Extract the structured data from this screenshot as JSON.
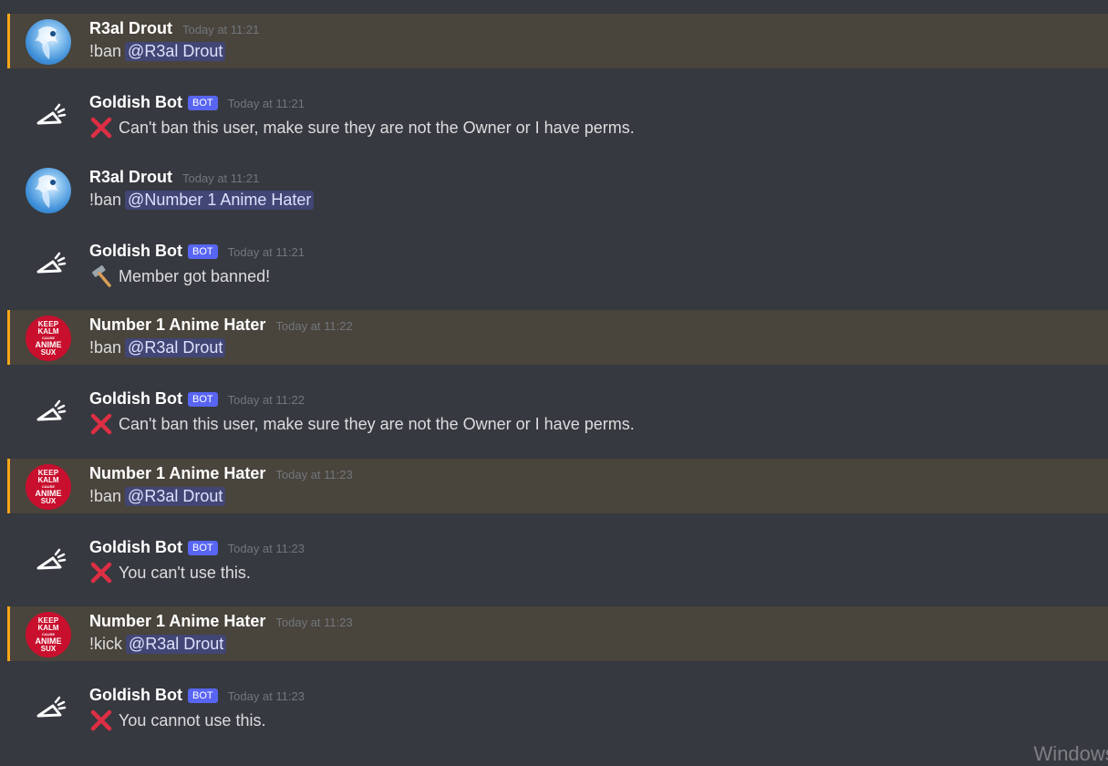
{
  "messages": [
    {
      "id": 1,
      "type": "user",
      "author": "R3al Drout",
      "avatar": "r3al-avatar",
      "timestamp": "Today at 11:21",
      "command": "!ban",
      "mention": "@R3al Drout",
      "highlighted": true
    },
    {
      "id": 2,
      "type": "bot",
      "author": "Goldish Bot",
      "bot_tag": "BOT",
      "avatar": "bot-broom-avatar",
      "timestamp": "Today at 11:21",
      "emoji": "cross-mark-icon",
      "text": "Can't ban this user, make sure they are not the Owner or I have perms."
    },
    {
      "id": 3,
      "type": "user",
      "author": "R3al Drout",
      "avatar": "r3al-avatar",
      "timestamp": "Today at 11:21",
      "command": "!ban",
      "mention": "@Number 1 Anime Hater",
      "highlighted": false
    },
    {
      "id": 4,
      "type": "bot",
      "author": "Goldish Bot",
      "bot_tag": "BOT",
      "avatar": "bot-broom-avatar",
      "timestamp": "Today at 11:21",
      "emoji": "hammer-icon",
      "text": "Member got banned!"
    },
    {
      "id": 5,
      "type": "user",
      "author": "Number 1 Anime Hater",
      "avatar": "keep-kalm-avatar",
      "timestamp": "Today at 11:22",
      "command": "!ban",
      "mention": "@R3al Drout",
      "highlighted": true
    },
    {
      "id": 6,
      "type": "bot",
      "author": "Goldish Bot",
      "bot_tag": "BOT",
      "avatar": "bot-broom-avatar",
      "timestamp": "Today at 11:22",
      "emoji": "cross-mark-icon",
      "text": "Can't ban this user, make sure they are not the Owner or I have perms."
    },
    {
      "id": 7,
      "type": "user",
      "author": "Number 1 Anime Hater",
      "avatar": "keep-kalm-avatar",
      "timestamp": "Today at 11:23",
      "command": "!ban",
      "mention": "@R3al Drout",
      "highlighted": true
    },
    {
      "id": 8,
      "type": "bot",
      "author": "Goldish Bot",
      "bot_tag": "BOT",
      "avatar": "bot-broom-avatar",
      "timestamp": "Today at 11:23",
      "emoji": "cross-mark-icon",
      "text": "You can't use this."
    },
    {
      "id": 9,
      "type": "user",
      "author": "Number 1 Anime Hater",
      "avatar": "keep-kalm-avatar",
      "timestamp": "Today at 11:23",
      "command": "!kick",
      "mention": "@R3al Drout",
      "highlighted": true
    },
    {
      "id": 10,
      "type": "bot",
      "author": "Goldish Bot",
      "bot_tag": "BOT",
      "avatar": "bot-broom-avatar",
      "timestamp": "Today at 11:23",
      "emoji": "cross-mark-icon",
      "text": "You cannot use this."
    }
  ],
  "hater_avatar_text": [
    "KEEP",
    "KALM",
    "CAUSE",
    "ANIME",
    "SUX"
  ],
  "watermark": "Windows'",
  "colors": {
    "background": "#36393f",
    "mention_highlight": "#49443c",
    "mention_border": "#faa61a",
    "bot_tag": "#5865f2",
    "mention_pill": "#414675",
    "cross_mark": "#dd2e44"
  }
}
